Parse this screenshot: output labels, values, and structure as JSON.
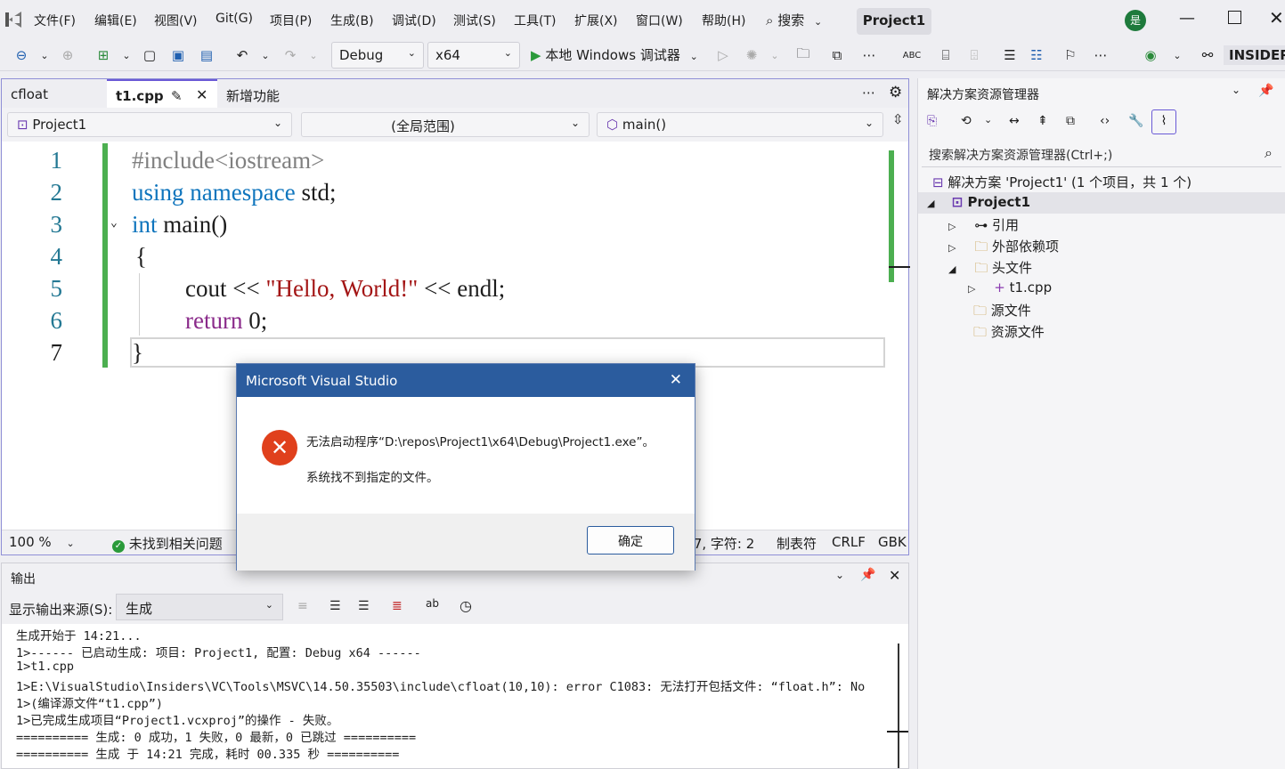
{
  "menubar": {
    "items": [
      "文件(F)",
      "编辑(E)",
      "视图(V)",
      "Git(G)",
      "项目(P)",
      "生成(B)",
      "调试(D)",
      "测试(S)",
      "工具(T)",
      "扩展(X)",
      "窗口(W)",
      "帮助(H)"
    ],
    "search_label": "搜索",
    "project_name": "Project1",
    "user_badge": "是"
  },
  "toolbar": {
    "config": "Debug",
    "platform": "x64",
    "run_label": "本地 Windows 调试器",
    "insider_label": "INSIDER"
  },
  "editor": {
    "tabs": [
      {
        "label": "cfloat"
      },
      {
        "label": "t1.cpp"
      },
      {
        "label": "新增功能"
      }
    ],
    "nav": {
      "project": "Project1",
      "scope": "(全局范围)",
      "member": "main()"
    },
    "line_numbers": [
      "1",
      "2",
      "3",
      "4",
      "5",
      "6",
      "7"
    ],
    "status": {
      "zoom": "100 %",
      "issues": "未找到相关问题",
      "position": "行: 7, 字符: 2",
      "tabs": "制表符",
      "eol": "CRLF",
      "encoding": "GBK"
    }
  },
  "code": {
    "l1": "#include<iostream>",
    "l2a": "using",
    "l2b": "namespace",
    "l2c": "std;",
    "l3a": "int",
    "l3b": "main()",
    "l4": "{",
    "l5a": "cout <<",
    "l5b": "\"Hello, World!\"",
    "l5c": "<< endl;",
    "l6a": "return",
    "l6b": "0;",
    "l7": "}"
  },
  "solution": {
    "title": "解决方案资源管理器",
    "search_placeholder": "搜索解决方案资源管理器(Ctrl+;)",
    "root": "解决方案 'Project1' (1 个项目，共 1 个)",
    "project": "Project1",
    "items": [
      "引用",
      "外部依赖项",
      "头文件",
      "t1.cpp",
      "源文件",
      "资源文件"
    ]
  },
  "output": {
    "title": "输出",
    "source_label": "显示输出来源(S):",
    "source_value": "生成",
    "lines": [
      "生成开始于 14:21...",
      "1>------ 已启动生成: 项目: Project1, 配置: Debug x64 ------",
      "1>t1.cpp",
      "1>E:\\VisualStudio\\Insiders\\VC\\Tools\\MSVC\\14.50.35503\\include\\cfloat(10,10): error C1083: 无法打开包括文件: “float.h”: No",
      "1>(编译源文件“t1.cpp”)",
      "1>已完成生成项目“Project1.vcxproj”的操作 - 失败。",
      "========== 生成: 0 成功，1 失败，0 最新，0 已跳过 ==========",
      "========== 生成 于 14:21 完成，耗时 00.335 秒 =========="
    ]
  },
  "dialog": {
    "title": "Microsoft Visual Studio",
    "message": "无法启动程序“D:\\repos\\Project1\\x64\\Debug\\Project1.exe”。",
    "detail": "系统找不到指定的文件。",
    "ok": "确定"
  },
  "colors": {
    "accent": "#2b5c9e",
    "keyword": "#0f75bd",
    "string": "#a31515",
    "error": "#e0401c",
    "change_bar": "#4caf50"
  }
}
